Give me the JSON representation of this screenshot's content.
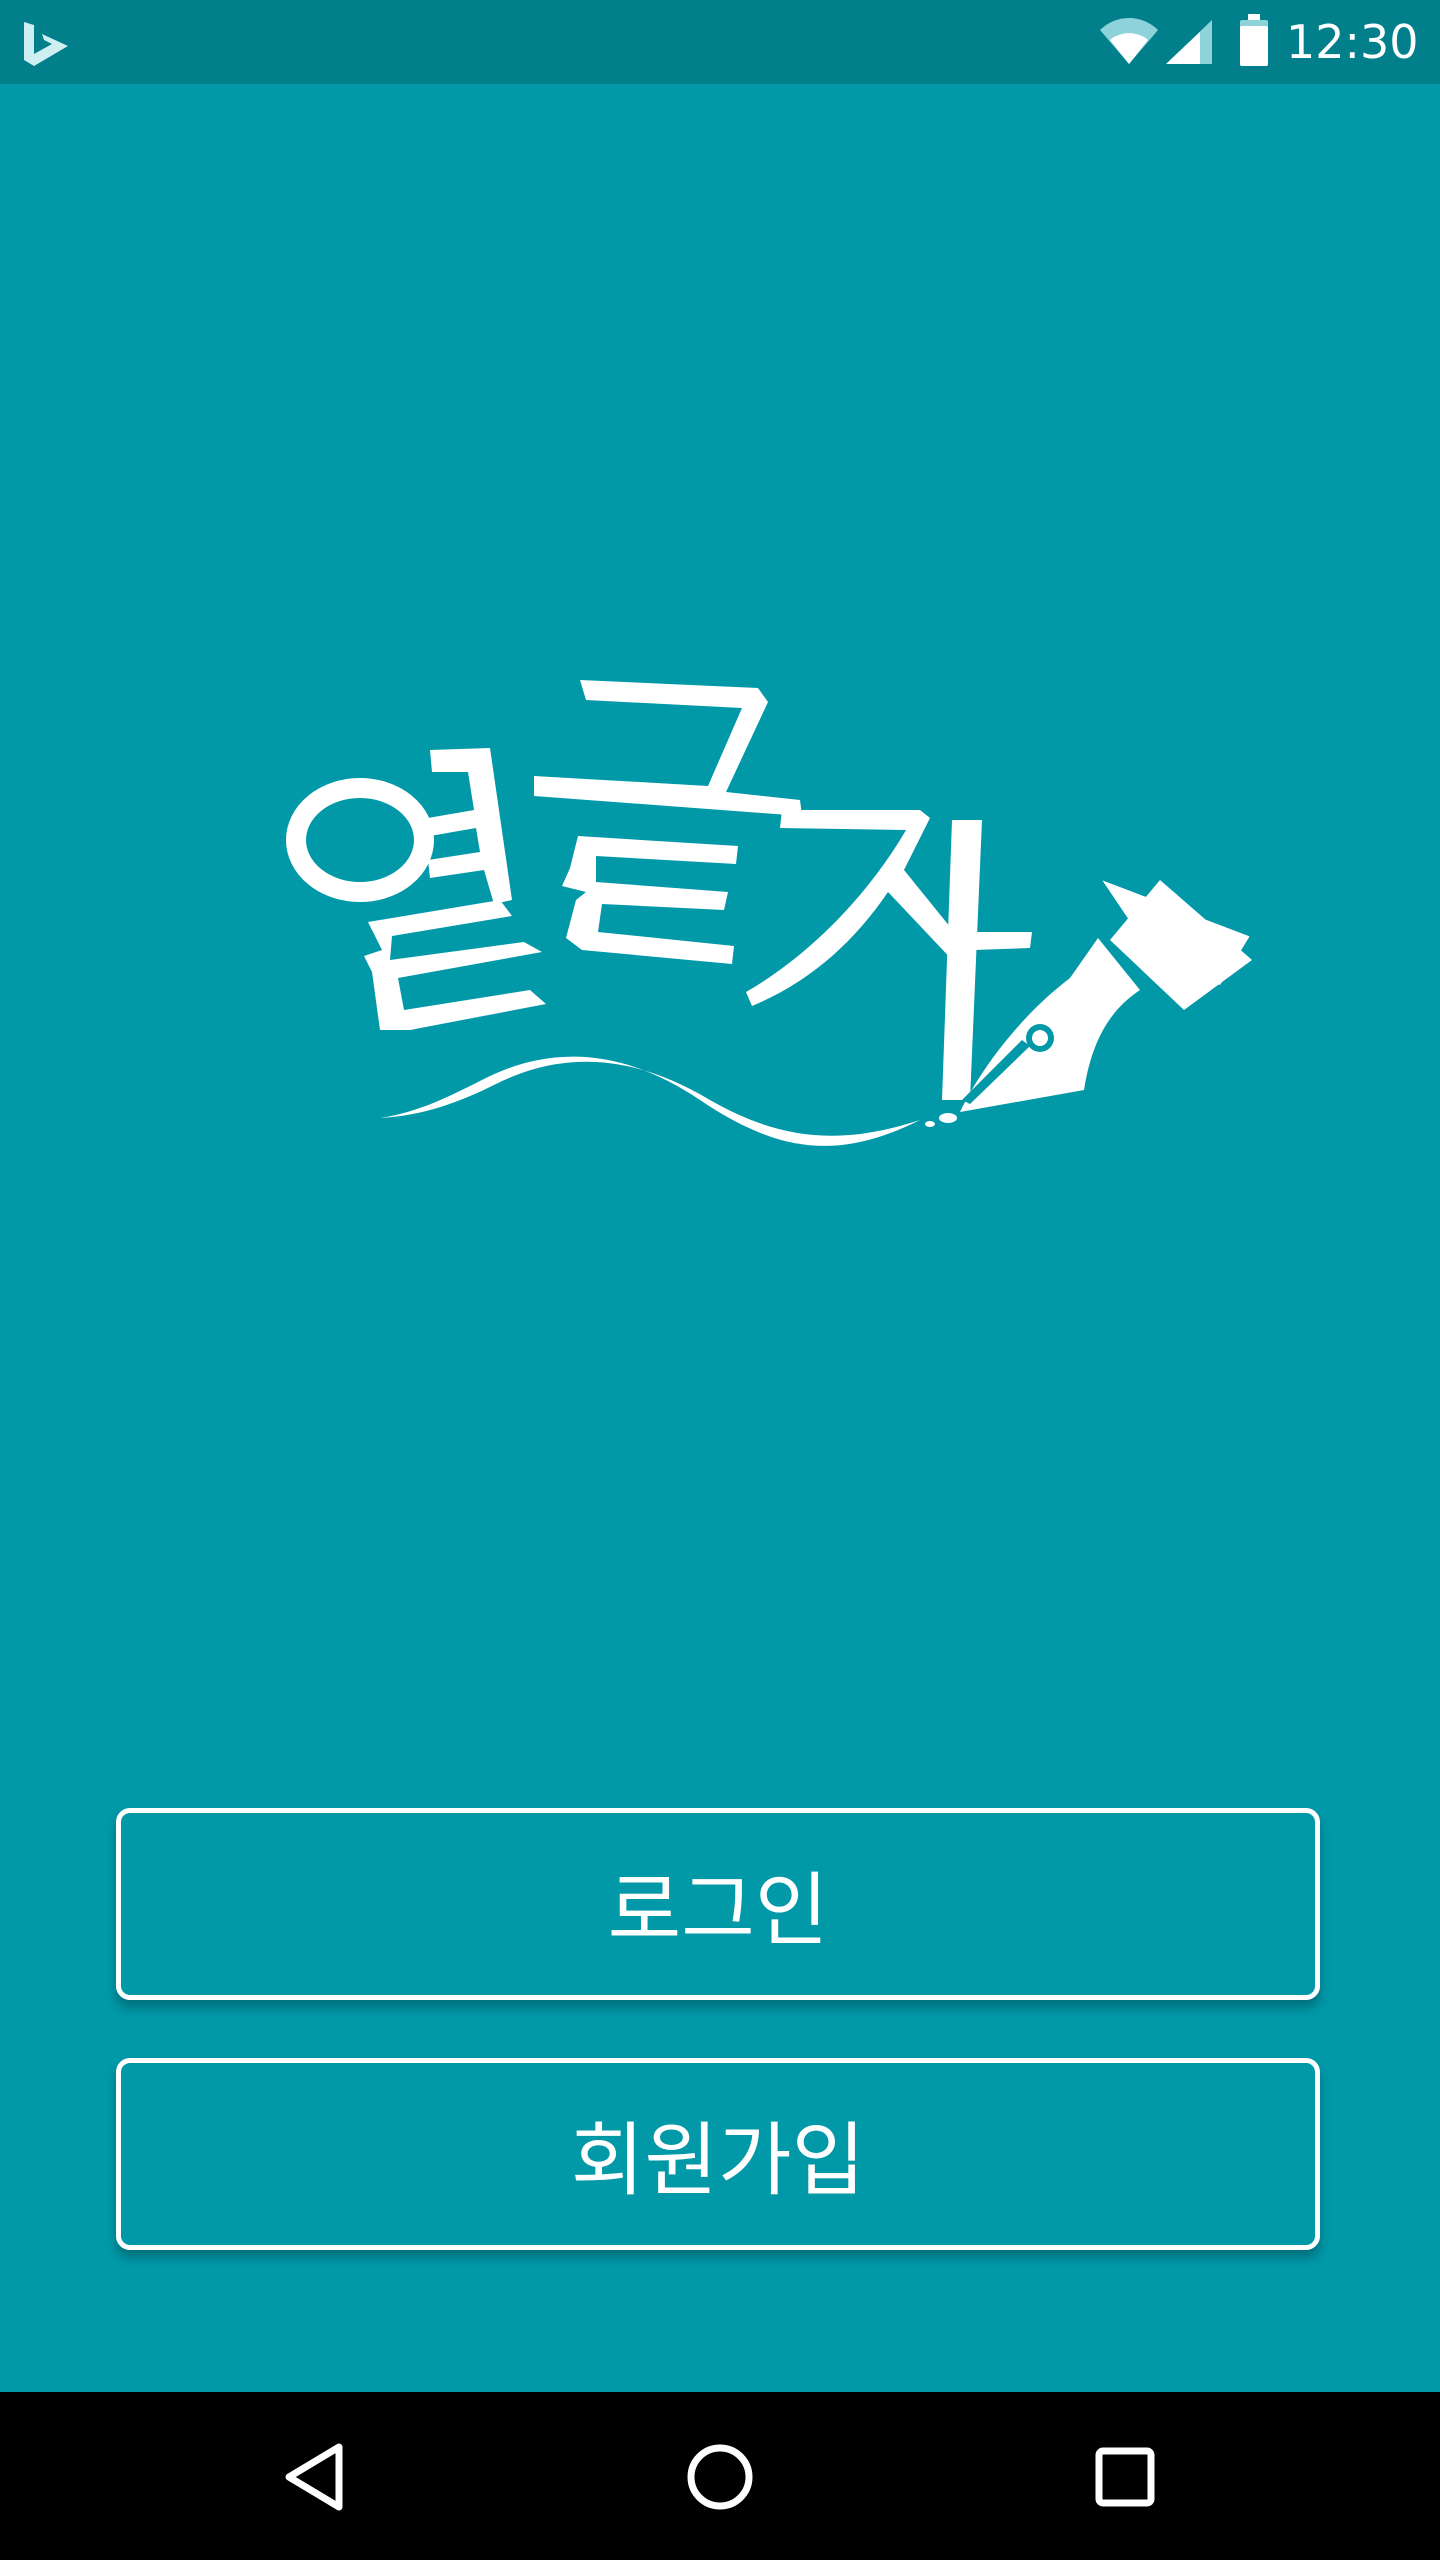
{
  "status_bar": {
    "time": "12:30",
    "icons": [
      "bing-icon",
      "wifi-icon",
      "cell-signal-icon",
      "battery-icon"
    ]
  },
  "logo": {
    "text": "열글자",
    "icon": "fountain-pen-icon"
  },
  "buttons": {
    "login_label": "로그인",
    "signup_label": "회원가입"
  },
  "nav_bar": {
    "icons": [
      "back-icon",
      "home-icon",
      "recents-icon"
    ]
  },
  "colors": {
    "background": "#0198a8",
    "status_bar": "#01808c",
    "foreground": "#ffffff",
    "nav_bar": "#000000"
  }
}
